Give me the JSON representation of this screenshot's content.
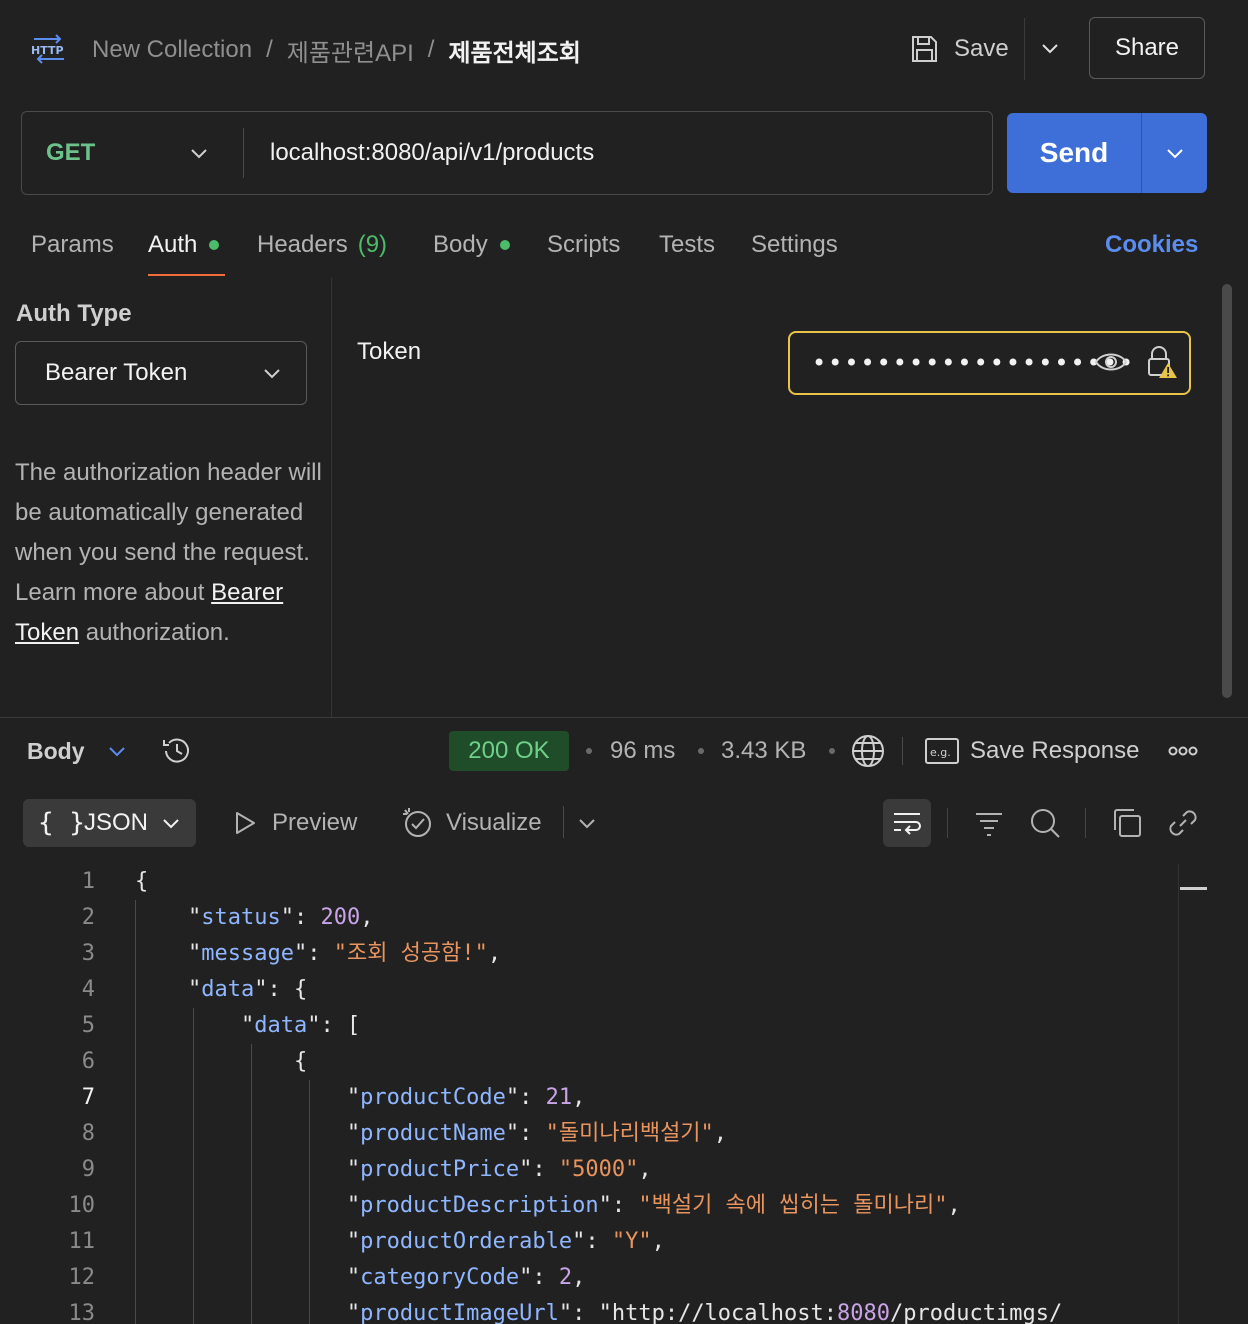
{
  "header": {
    "breadcrumb": [
      "New Collection",
      "제품관련API"
    ],
    "separator": "/",
    "current": "제품전체조회",
    "save_label": "Save",
    "share_label": "Share"
  },
  "request": {
    "method": "GET",
    "url": "localhost:8080/api/v1/products",
    "send_label": "Send"
  },
  "tabs": {
    "params": "Params",
    "auth": "Auth",
    "headers": "Headers",
    "headers_count": "(9)",
    "body": "Body",
    "scripts": "Scripts",
    "tests": "Tests",
    "settings": "Settings",
    "cookies": "Cookies",
    "active": "Auth"
  },
  "auth": {
    "type_title": "Auth Type",
    "type_value": "Bearer Token",
    "help_text_1": "The authorization header will be automatically generated when you send the request. Learn more about ",
    "help_link": "Bearer Token",
    "help_text_2": " authorization.",
    "token_label": "Token",
    "token_masked": "••••••••••••••••••••"
  },
  "response": {
    "body_label": "Body",
    "status": "200 OK",
    "time": "96 ms",
    "size": "3.43 KB",
    "save_response_label": "Save Response",
    "format": "JSON",
    "format_braces": "{ }",
    "preview_label": "Preview",
    "visualize_label": "Visualize"
  },
  "code_lines": [
    {
      "n": "1",
      "text": "{"
    },
    {
      "n": "2",
      "text": "    \"status\": 200,"
    },
    {
      "n": "3",
      "text": "    \"message\": \"조회 성공함!\","
    },
    {
      "n": "4",
      "text": "    \"data\": {"
    },
    {
      "n": "5",
      "text": "        \"data\": ["
    },
    {
      "n": "6",
      "text": "            {"
    },
    {
      "n": "7",
      "text": "                \"productCode\": 21,"
    },
    {
      "n": "8",
      "text": "                \"productName\": \"돌미나리백설기\","
    },
    {
      "n": "9",
      "text": "                \"productPrice\": \"5000\","
    },
    {
      "n": "10",
      "text": "                \"productDescription\": \"백설기 속에 씹히는 돌미나리\","
    },
    {
      "n": "11",
      "text": "                \"productOrderable\": \"Y\","
    },
    {
      "n": "12",
      "text": "                \"categoryCode\": 2,"
    },
    {
      "n": "13",
      "text": "                \"productImageUrl\": \"http://localhost:8080/productimgs/"
    }
  ],
  "colors": {
    "accent_send": "#3e6fd8",
    "method_get": "#6cc28a",
    "status_ok": "#6fd08a",
    "tab_underline": "#f26b3a",
    "token_warning_border": "#e8c34a",
    "json_key": "#8fb6ff",
    "json_string": "#e8945e",
    "json_number": "#c9a5e8"
  },
  "icons": {
    "http": "http-icon",
    "save": "floppy-icon",
    "eye": "eye-icon",
    "lock_warning": "lock-warning-icon",
    "history": "history-icon",
    "globe": "globe-icon",
    "example": "eg-icon",
    "more": "more-icon",
    "preview": "play-icon",
    "visualize": "visualize-icon",
    "wrap": "wrap-icon",
    "filter": "filter-icon",
    "search": "search-icon",
    "copy": "copy-icon",
    "link": "link-icon"
  }
}
